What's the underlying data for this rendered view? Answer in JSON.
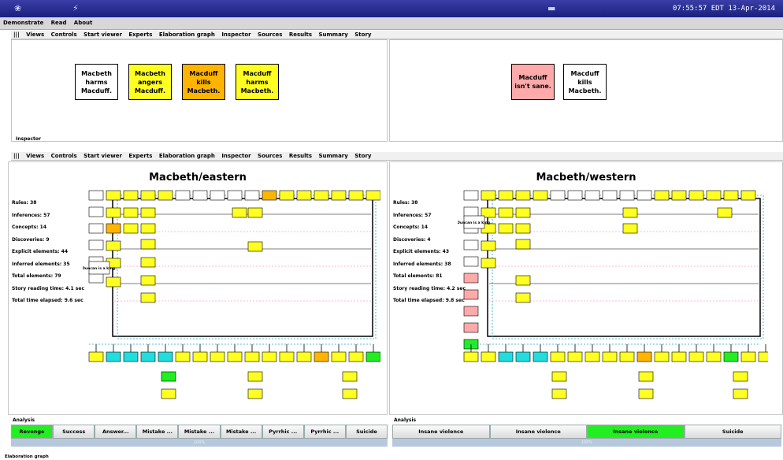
{
  "system_bar": {
    "clock": "07:55:57 EDT 13-Apr-2014"
  },
  "menu": [
    "Demonstrate",
    "Read",
    "About"
  ],
  "views_menu": [
    "|||",
    "Views",
    "Controls",
    "Start viewer",
    "Experts",
    "Elaboration graph",
    "Inspector",
    "Sources",
    "Results",
    "Summary",
    "Story"
  ],
  "top_left_boxes": [
    {
      "text": "Macbeth harms Macduff.",
      "color": "#ffffff"
    },
    {
      "text": "Macbeth angers Macduff.",
      "color": "#ffff22"
    },
    {
      "text": "Macduff kills Macbeth.",
      "color": "#ffb400"
    },
    {
      "text": "Macduff harms Macbeth.",
      "color": "#ffff22"
    }
  ],
  "top_right_boxes": [
    {
      "text": "Macduff isn't sane.",
      "color": "#ffaaaa"
    },
    {
      "text": "Macduff kills Macbeth.",
      "color": "#ffffff"
    }
  ],
  "inspector_label": "Inspector",
  "left_panel": {
    "title": "Macbeth/eastern",
    "stats": [
      "Rules: 38",
      "Inferences: 57",
      "Concepts: 14",
      "Discoveries: 9",
      "Explicit elements: 44",
      "Inferred elements: 35",
      "Total elements: 79",
      "Story reading time: 4.1 sec",
      "Total time elapsed: 9.6 sec"
    ],
    "node_label": "Duncan is a king.",
    "analysis_label": "Analysis",
    "buttons": [
      "Revenge",
      "Success",
      "Answer...",
      "Mistake ...",
      "Mistake ...",
      "Mistake ...",
      "Pyrrhic ...",
      "Pyrrhic ...",
      "Suicide"
    ],
    "progress": "100%"
  },
  "right_panel": {
    "title": "Macbeth/western",
    "stats": [
      "Rules: 38",
      "Inferences: 57",
      "Concepts: 14",
      "Discoveries: 4",
      "Explicit elements: 43",
      "Inferred elements: 38",
      "Total elements: 81",
      "Story reading time: 4.2 sec",
      "Total time elapsed: 9.8 sec"
    ],
    "node_label": "Duncan is a king.",
    "analysis_label": "Analysis",
    "buttons": [
      "Insane violence",
      "Insane violence",
      "Insane violence",
      "Suicide"
    ],
    "progress": "100%"
  },
  "footer": "Elaboration graph",
  "colors": {
    "yellow": "#ffff22",
    "orange": "#ffb400",
    "cyan": "#22dddd",
    "green": "#22ee22",
    "pink": "#ffaaaa"
  }
}
